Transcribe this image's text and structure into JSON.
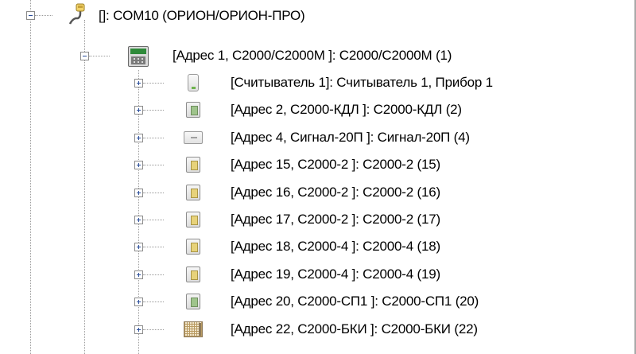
{
  "tree": {
    "root": {
      "label": "[]: COM10 (ОРИОН/ОРИОН-ПРО)",
      "icon": "com-port-icon",
      "expanded": true
    },
    "controller": {
      "label": "[Адрес 1, С2000/С2000М ]: С2000/С2000М (1)",
      "icon": "control-panel-icon",
      "expanded": true
    },
    "children": [
      {
        "label": "[Считыватель 1]: Считыватель 1, Прибор 1",
        "icon": "reader-icon",
        "icon_class": "ic-reader"
      },
      {
        "label": "[Адрес 2, С2000-КДЛ ]: С2000-КДЛ (2)",
        "icon": "kdl-device-icon",
        "icon_class": "ic-kdl"
      },
      {
        "label": "[Адрес 4, Сигнал-20П ]: Сигнал-20П (4)",
        "icon": "signal-device-icon",
        "icon_class": "ic-signal"
      },
      {
        "label": "[Адрес 15, С2000-2 ]: С2000-2 (15)",
        "icon": "c2000-2-device-icon",
        "icon_class": "ic-yellow"
      },
      {
        "label": "[Адрес 16, С2000-2 ]: С2000-2 (16)",
        "icon": "c2000-2-device-icon",
        "icon_class": "ic-yellow"
      },
      {
        "label": "[Адрес 17, С2000-2 ]: С2000-2 (17)",
        "icon": "c2000-2-device-icon",
        "icon_class": "ic-yellow"
      },
      {
        "label": "[Адрес 18, С2000-4 ]: С2000-4 (18)",
        "icon": "c2000-4-device-icon",
        "icon_class": "ic-yellow"
      },
      {
        "label": "[Адрес 19, С2000-4 ]: С2000-4 (19)",
        "icon": "c2000-4-device-icon",
        "icon_class": "ic-yellow"
      },
      {
        "label": "[Адрес 20, С2000-СП1 ]: С2000-СП1 (20)",
        "icon": "sp1-device-icon",
        "icon_class": "ic-kdl"
      },
      {
        "label": "[Адрес 22, С2000-БКИ ]: С2000-БКИ (22)",
        "icon": "bki-device-icon",
        "icon_class": "ic-bki"
      }
    ]
  }
}
